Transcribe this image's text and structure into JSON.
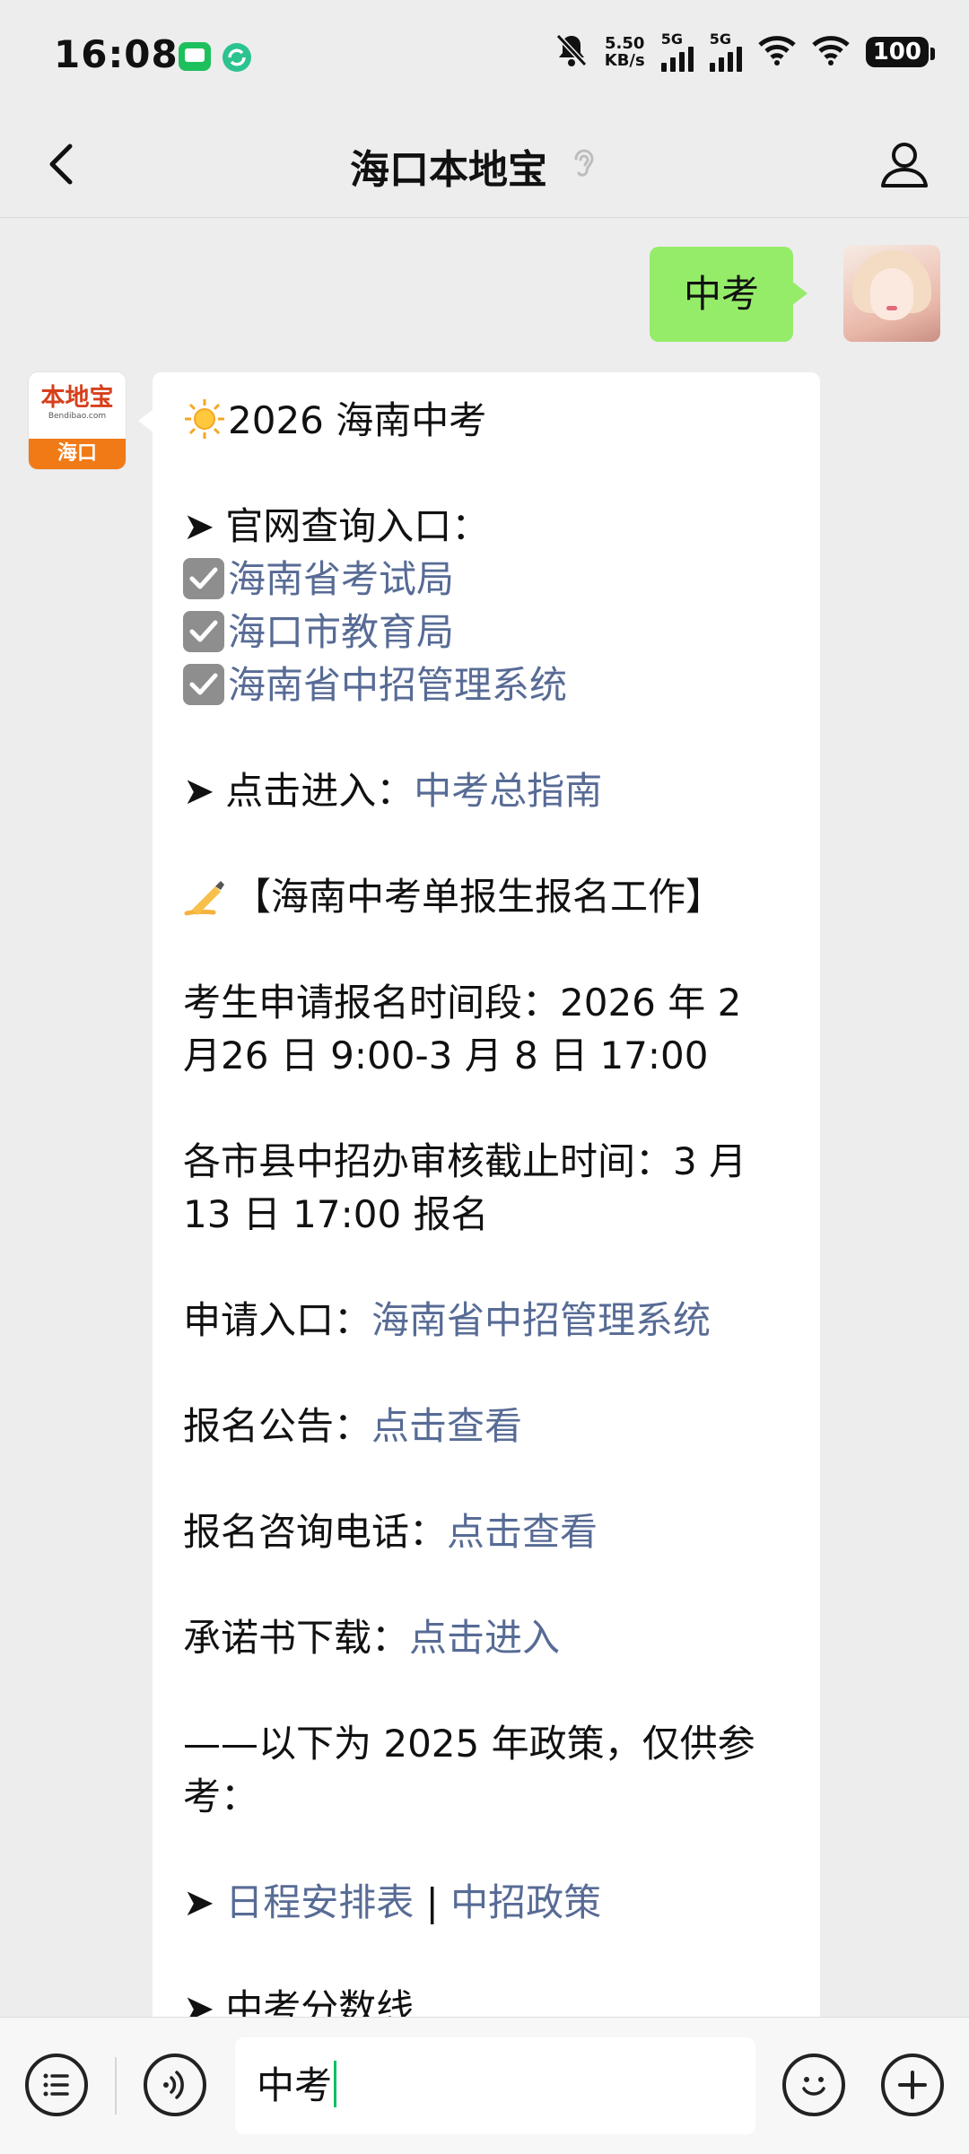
{
  "status_bar": {
    "time": "16:08",
    "net_speed_value": "5.50",
    "net_speed_unit": "KB/s",
    "sim1": "5G",
    "sim2": "5G",
    "battery": "100"
  },
  "header": {
    "title": "海口本地宝"
  },
  "user_message": {
    "text": "中考"
  },
  "bot_avatar": {
    "brand_cn": "本地宝",
    "brand_en": "Bendibao.com",
    "city": "海口"
  },
  "bot_message": {
    "title": "2026 海南中考",
    "official_label": "官网查询入口：",
    "official_links": [
      "海南省考试局",
      "海口市教育局",
      "海南省中招管理系统"
    ],
    "guide_label": "点击进入：",
    "guide_link": "中考总指南",
    "section_title": "【海南中考单报生报名工作】",
    "apply_period_1": "考生申请报名时间段：2026 年 2",
    "apply_period_2": "月26 日 9:00-3 月 8 日 17:00",
    "review_deadline_1": "各市县中招办审核截止时间：3 月",
    "review_deadline_2": "13 日 17:00 报名",
    "apply_entry_label": "申请入口：",
    "apply_entry_link": "海南省中招管理系统",
    "notice_label": "报名公告：",
    "notice_link": "点击查看",
    "phone_label": "报名咨询电话：",
    "phone_link": "点击查看",
    "pledge_label": "承诺书下载：",
    "pledge_link": "点击进入",
    "ref_note_1": "——以下为 2025 年政策，仅供参",
    "ref_note_2": "考：",
    "schedule_link": "日程安排表",
    "separator": "|",
    "policy_link": "中招政策",
    "score_line": "中考分数线"
  },
  "input_bar": {
    "value": "中考"
  },
  "colors": {
    "user_bubble": "#95ec69",
    "link": "#576b95",
    "cursor": "#07c160",
    "background": "#ededed"
  }
}
